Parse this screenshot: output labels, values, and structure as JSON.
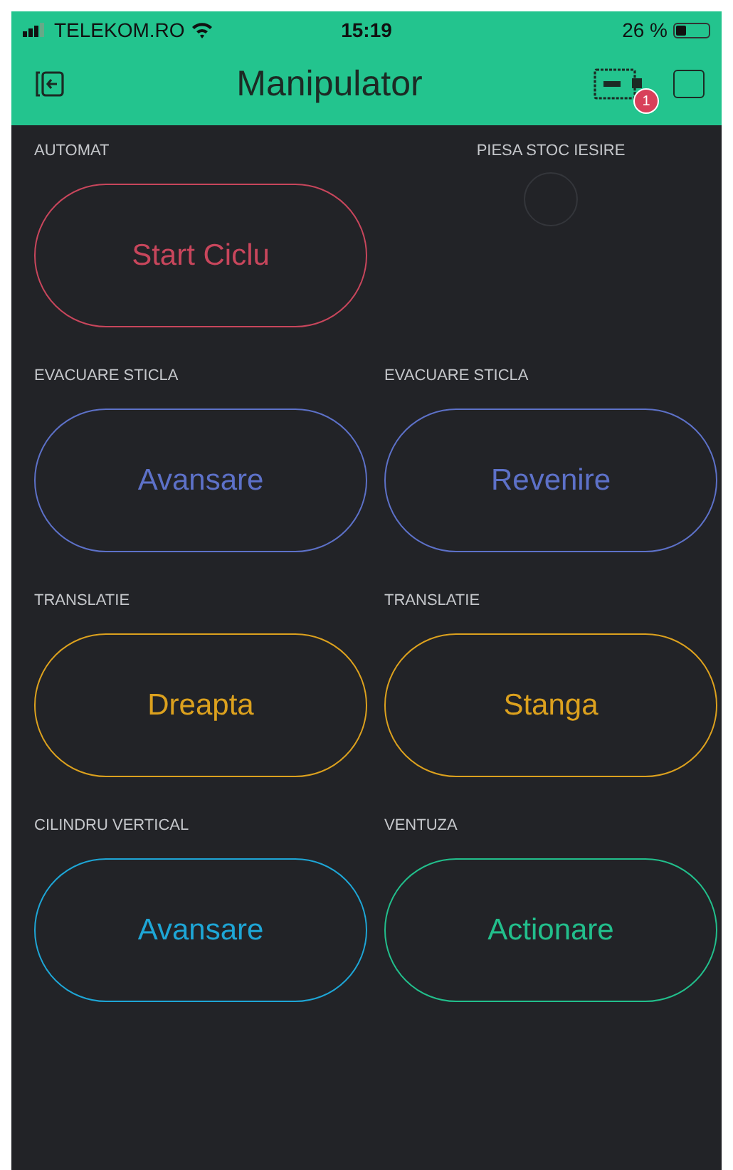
{
  "status_bar": {
    "carrier": "TELEKOM.RO",
    "time": "15:19",
    "battery": "26 %"
  },
  "header": {
    "title": "Manipulator",
    "device_badge": "1"
  },
  "widgets": [
    {
      "kind": "button",
      "label": "AUTOMAT",
      "text": "Start Ciclu",
      "color": "#c8465c"
    },
    {
      "kind": "led",
      "label": "PIESA STOC IESIRE",
      "on": false
    },
    {
      "kind": "button",
      "label": "EVACUARE STICLA",
      "text": "Avansare",
      "color": "#5d71c8"
    },
    {
      "kind": "button",
      "label": "EVACUARE STICLA",
      "text": "Revenire",
      "color": "#5d71c8"
    },
    {
      "kind": "button",
      "label": "TRANSLATIE",
      "text": "Dreapta",
      "color": "#dca11e"
    },
    {
      "kind": "button",
      "label": "TRANSLATIE",
      "text": "Stanga",
      "color": "#dca11e"
    },
    {
      "kind": "button",
      "label": "CILINDRU VERTICAL",
      "text": "Avansare",
      "color": "#1ea6d6"
    },
    {
      "kind": "button",
      "label": "VENTUZA",
      "text": "Actionare",
      "color": "#22bf8c"
    }
  ]
}
